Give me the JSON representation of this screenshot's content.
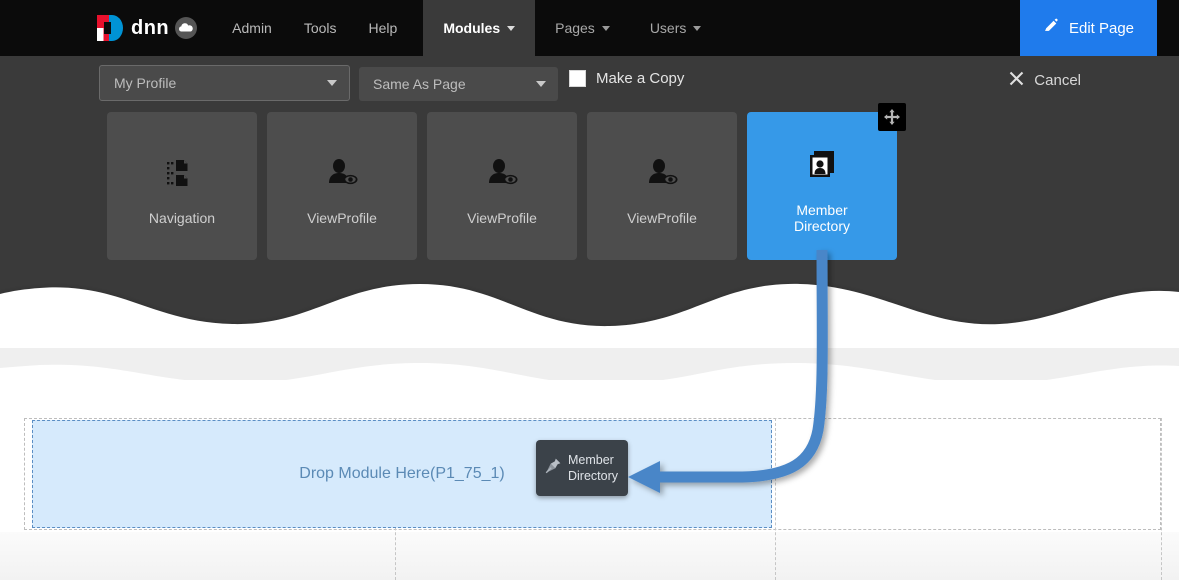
{
  "colors": {
    "accent_blue": "#1f7bec",
    "tile_selected": "#3699e8",
    "topbar_black": "#0b0b0b",
    "panel_dark": "#3a3a3a",
    "tile_gray": "#4d4d4d",
    "dropzone_fill": "#d6eafc",
    "dropzone_border": "#5b8ec4",
    "arrow_blue": "#4a86c8",
    "ghost_dark": "#3b4249",
    "logo_red": "#e8112d",
    "logo_blue": "#0093d5"
  },
  "topbar": {
    "logo": {
      "mark_icon": "dnn-d-mark-icon",
      "text": "dnn",
      "cloud_icon": "cloud-icon"
    },
    "links": [
      {
        "label": "Admin",
        "name": "nav-link-admin"
      },
      {
        "label": "Tools",
        "name": "nav-link-tools"
      },
      {
        "label": "Help",
        "name": "nav-link-help"
      }
    ],
    "tabs": [
      {
        "label": "Modules",
        "name": "nav-tab-modules",
        "active": true,
        "caret_icon": "chevron-down-icon"
      },
      {
        "label": "Pages",
        "name": "nav-tab-pages",
        "active": false,
        "caret_icon": "chevron-down-icon"
      },
      {
        "label": "Users",
        "name": "nav-tab-users",
        "active": false,
        "caret_icon": "chevron-down-icon"
      }
    ],
    "edit_page": {
      "label": "Edit Page",
      "icon": "pencil-icon"
    }
  },
  "toolbar": {
    "module_select": {
      "value": "My Profile",
      "caret_icon": "chevron-down-icon"
    },
    "pane_select": {
      "value": "Same As Page",
      "caret_icon": "chevron-down-icon"
    },
    "make_a_copy": {
      "label": "Make a Copy",
      "checked": false
    },
    "cancel": {
      "label": "Cancel",
      "icon": "close-x-icon"
    }
  },
  "module_tiles": [
    {
      "label": "Navigation",
      "icon": "sitemap-icon",
      "selected": false
    },
    {
      "label": "ViewProfile",
      "icon": "user-eye-icon",
      "selected": false
    },
    {
      "label": "ViewProfile",
      "icon": "user-eye-icon",
      "selected": false
    },
    {
      "label": "ViewProfile",
      "icon": "user-eye-icon",
      "selected": false
    },
    {
      "label": "Member Directory",
      "label_line1": "Member",
      "label_line2": "Directory",
      "icon": "contact-cards-icon",
      "selected": true,
      "handle_icon": "move-arrows-icon"
    }
  ],
  "content": {
    "dropzone_label": "Drop Module Here(P1_75_1)"
  },
  "drag_ghost": {
    "icon": "pin-icon",
    "label_line1": "Member",
    "label_line2": "Directory"
  },
  "annotation": {
    "arrow_icon": "curved-arrow-icon",
    "description": "Curved arrow from Member Directory tile to drop target"
  }
}
